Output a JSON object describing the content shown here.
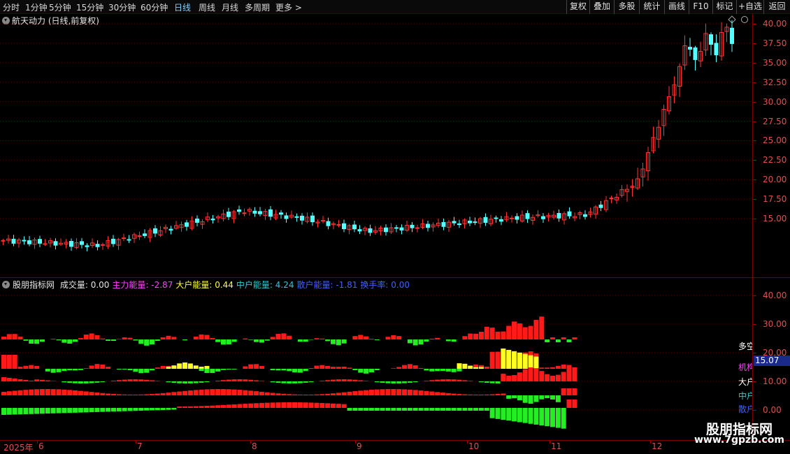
{
  "toolbar": {
    "periods": [
      "分时",
      "1分钟",
      "5分钟",
      "15分钟",
      "30分钟",
      "60分钟",
      "日线",
      "周线",
      "月线",
      "多周期",
      "更多 >"
    ],
    "active_period": "日线",
    "buttons": [
      "复权",
      "叠加",
      "多股",
      "统计",
      "画线",
      "F10",
      "标记",
      "+自选",
      "返回"
    ]
  },
  "price_panel": {
    "title": "航天动力 (日线,前复权)",
    "y_ticks": [
      "40.00",
      "37.50",
      "35.00",
      "32.50",
      "30.00",
      "27.50",
      "25.00",
      "22.50",
      "20.00",
      "17.50",
      "15.00"
    ]
  },
  "indicator_panel": {
    "name": "股朋指标网",
    "legend": [
      {
        "label": "成交量: 0.00",
        "color": "#e6e6e6"
      },
      {
        "label": "主力能量: -2.87",
        "color": "#ff40ff"
      },
      {
        "label": "大户能量: 0.44",
        "color": "#ffff40"
      },
      {
        "label": "中户能量: 4.24",
        "color": "#30c8d8"
      },
      {
        "label": "散户能量: -1.81",
        "color": "#4060ff"
      },
      {
        "label": "换手率: 0.00",
        "color": "#4060ff"
      }
    ],
    "y_ticks": [
      "40.00",
      "30.00",
      "20.00",
      "10.00",
      "0.00"
    ],
    "side_labels": [
      {
        "text": "多空",
        "color": "#ffffff"
      },
      {
        "text": "机构",
        "color": "#ff40ff"
      },
      {
        "text": "大户",
        "color": "#ffffff"
      },
      {
        "text": "中户",
        "color": "#30c8d8"
      },
      {
        "text": "散户",
        "color": "#4060ff"
      }
    ],
    "price_tag": "15.07"
  },
  "date_axis": [
    "2025年",
    "6",
    "7",
    "8",
    "9",
    "10",
    "11",
    "12"
  ],
  "watermark": {
    "title": "股朋指标网",
    "url": "www.7gpzb.com"
  },
  "colors": {
    "up": "#ff3333",
    "down": "#54ffff",
    "bar_up": "#ff1a1a",
    "bar_down": "#22ee22",
    "bar_yellow": "#ffff22",
    "grid": "#5a0000"
  }
}
